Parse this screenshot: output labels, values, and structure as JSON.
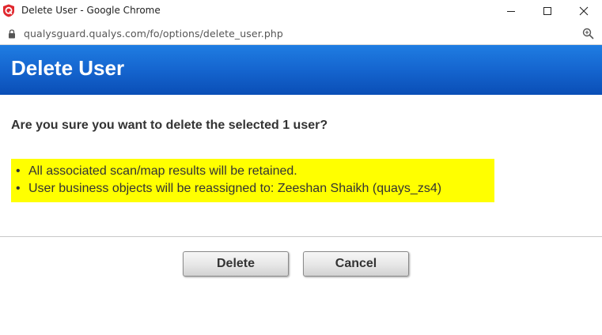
{
  "window": {
    "title": "Delete User - Google Chrome",
    "url": "qualysguard.qualys.com/fo/options/delete_user.php"
  },
  "header": {
    "title": "Delete User"
  },
  "dialog": {
    "question": "Are you sure you want to delete the selected 1 user?",
    "notices": [
      "All associated scan/map results will be retained.",
      "User business objects will be reassigned to: Zeeshan Shaikh (quays_zs4)"
    ],
    "delete_label": "Delete",
    "cancel_label": "Cancel"
  },
  "colors": {
    "header_blue": "#1565cf",
    "highlight": "#ffff00",
    "brand_red": "#e0282e"
  },
  "icons": {
    "app": "qualys-shield-icon",
    "lock": "lock-icon",
    "zoom": "zoom-icon",
    "minimize": "minimize-icon",
    "maximize": "maximize-icon",
    "close": "close-icon"
  }
}
